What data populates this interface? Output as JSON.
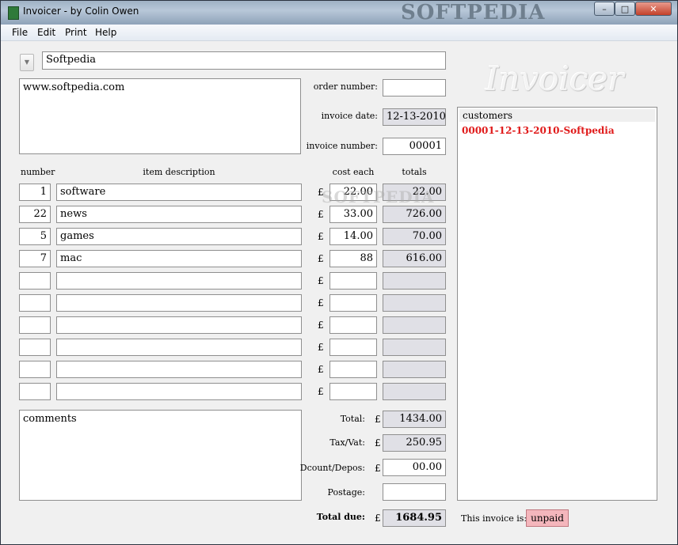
{
  "window": {
    "title": "Invoicer - by Colin Owen",
    "watermark": "SOFTPEDIA",
    "controls": {
      "minimize": "–",
      "maximize": "□",
      "close": "✕"
    }
  },
  "menu": [
    "File",
    "Edit",
    "Print",
    "Help"
  ],
  "customer_name": "Softpedia",
  "address": "www.softpedia.com",
  "labels": {
    "order_number": "order number:",
    "invoice_date": "invoice date:",
    "invoice_number": "invoice number:",
    "number": "number",
    "item_description": "item description",
    "cost_each": "cost each",
    "totals": "totals",
    "total": "Total:",
    "tax_vat": "Tax/Vat:",
    "discount": "Dcount/Depos:",
    "postage": "Postage:",
    "total_due": "Total due:",
    "this_invoice_is": "This invoice is:"
  },
  "currency": "£",
  "order_number": "",
  "invoice_date": "12-13-2010",
  "invoice_number": "00001",
  "items": [
    {
      "number": "1",
      "description": "software",
      "cost": "22.00",
      "total": "22.00"
    },
    {
      "number": "22",
      "description": "news",
      "cost": "33.00",
      "total": "726.00"
    },
    {
      "number": "5",
      "description": "games",
      "cost": "14.00",
      "total": "70.00"
    },
    {
      "number": "7",
      "description": "mac",
      "cost": "88",
      "total": "616.00"
    },
    {
      "number": "",
      "description": "",
      "cost": "",
      "total": ""
    },
    {
      "number": "",
      "description": "",
      "cost": "",
      "total": ""
    },
    {
      "number": "",
      "description": "",
      "cost": "",
      "total": ""
    },
    {
      "number": "",
      "description": "",
      "cost": "",
      "total": ""
    },
    {
      "number": "",
      "description": "",
      "cost": "",
      "total": ""
    },
    {
      "number": "",
      "description": "",
      "cost": "",
      "total": ""
    }
  ],
  "comments": "comments",
  "totals": {
    "total": "1434.00",
    "tax_vat": "250.95",
    "discount": "00.00",
    "postage": "",
    "total_due": "1684.95"
  },
  "logo_text": "Invoicer",
  "customers": {
    "header": "customers",
    "items": [
      "00001-12-13-2010-Softpedia"
    ]
  },
  "status": "unpaid",
  "colors": {
    "customer_item": "#e01a1a",
    "status_bg": "#f4b6bc",
    "readonly_bg": "#e0e0e6"
  }
}
